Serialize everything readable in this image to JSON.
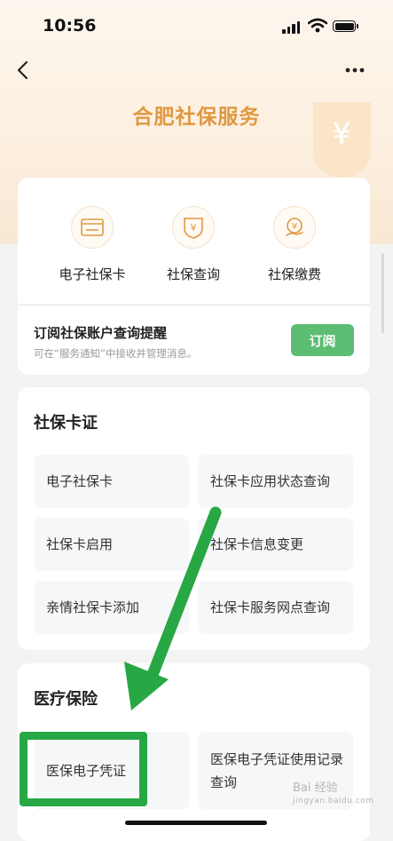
{
  "status_bar": {
    "time": "10:56"
  },
  "header": {
    "title": "合肥社保服务"
  },
  "services": [
    {
      "label": "电子社保卡",
      "icon": "card-icon"
    },
    {
      "label": "社保查询",
      "icon": "yuan-shield-icon"
    },
    {
      "label": "社保缴费",
      "icon": "yuan-hand-icon"
    }
  ],
  "subscribe": {
    "title": "订阅社保账户查询提醒",
    "desc": "可在“服务通知”中接收并管理消息。",
    "button": "订阅"
  },
  "section_card": {
    "title": "社保卡证",
    "items": [
      "电子社保卡",
      "社保卡应用状态查询",
      "社保卡启用",
      "社保卡信息变更",
      "亲情社保卡添加",
      "社保卡服务网点查询"
    ]
  },
  "section_medical": {
    "title": "医疗保险",
    "items": [
      "医保电子凭证",
      "医保电子凭证使用记录查询"
    ]
  },
  "watermark": {
    "line1": "Bai 经验",
    "line2": "jingyan.baidu.com"
  },
  "colors": {
    "accent": "#e09840",
    "button_green": "#5cbd73",
    "annotation_green": "#27a844"
  }
}
